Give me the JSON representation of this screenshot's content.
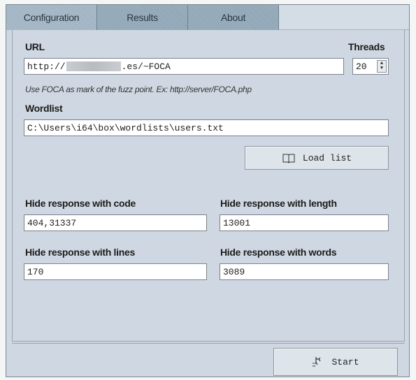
{
  "tabs": [
    "Configuration",
    "Results",
    "About"
  ],
  "url": {
    "label": "URL",
    "value_prefix": "http://",
    "value_suffix": ".es/~FOCA",
    "hint": "Use FOCA as mark of the fuzz point. Ex: http://server/FOCA.php"
  },
  "threads": {
    "label": "Threads",
    "value": "20"
  },
  "wordlist": {
    "label": "Wordlist",
    "value": "C:\\Users\\i64\\box\\wordlists\\users.txt",
    "load_button": "Load list",
    "load_icon": "book-icon"
  },
  "filters": {
    "code_label": "Hide response with code",
    "code_value": "404,31337",
    "length_label": "Hide response with length",
    "length_value": "13001",
    "lines_label": "Hide response with lines",
    "lines_value": "170",
    "words_label": "Hide response with words",
    "words_value": "3089"
  },
  "start": {
    "label": "Start",
    "icon": "run-icon"
  }
}
